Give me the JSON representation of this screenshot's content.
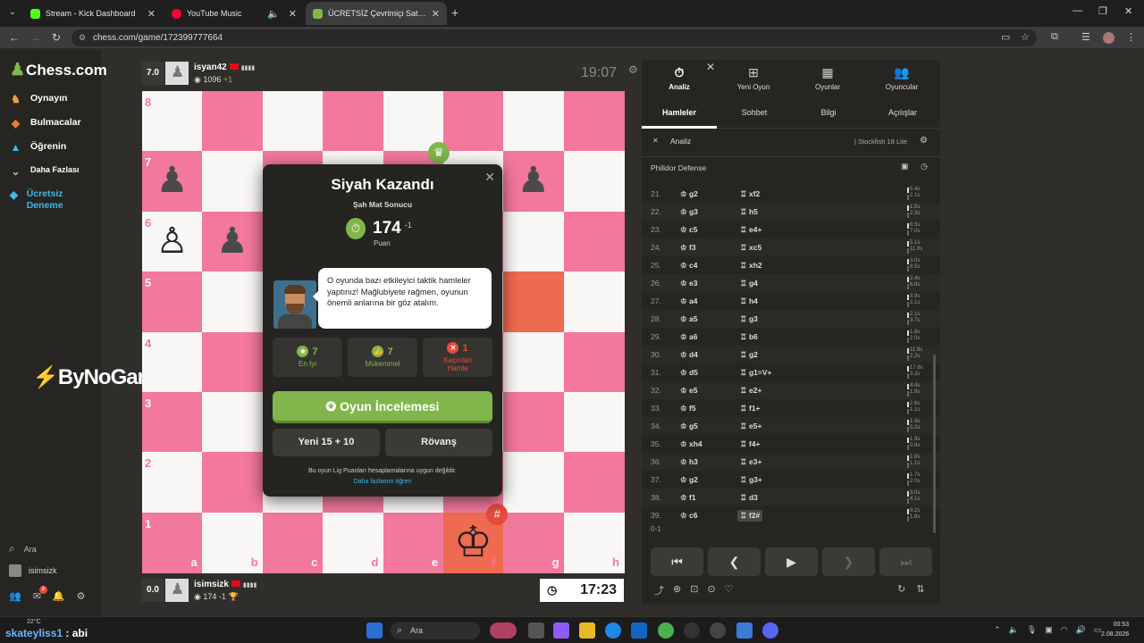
{
  "browser": {
    "tabs": [
      {
        "title": "Stream - Kick Dashboard",
        "favicon_color": "#53fc18",
        "active": false
      },
      {
        "title": "YouTube Music",
        "favicon_color": "#ff0033",
        "active": false
      },
      {
        "title": "ÜCRETSİZ Çevrimiçi Satranç Oy",
        "favicon_color": "#81b64c",
        "active": true
      }
    ],
    "url": "chess.com/game/172399777664"
  },
  "nav": {
    "logo_text": "Chess.com",
    "items": [
      {
        "label": "Oynayın",
        "icon": "play-icon"
      },
      {
        "label": "Bulmacalar",
        "icon": "puzzle-icon"
      },
      {
        "label": "Öğrenin",
        "icon": "learn-icon"
      },
      {
        "label": "Daha Fazlası",
        "icon": "chevron-down-icon"
      },
      {
        "label": "Ücretsiz Deneme",
        "icon": "diamond-icon"
      }
    ],
    "search_label": "Ara",
    "username": "isimsizk",
    "notifications_count": "3"
  },
  "overlay": {
    "brand": "ByNoGame"
  },
  "top_player": {
    "eval": "7.0",
    "name": "isyan42",
    "rating": "1096",
    "rating_change": "+1",
    "clock": "19:07"
  },
  "bottom_player": {
    "eval": "0.0",
    "name": "isimsizk",
    "rating": "174",
    "rating_change": "-1",
    "clock": "17:23"
  },
  "board": {
    "files": [
      "a",
      "b",
      "c",
      "d",
      "e",
      "f",
      "g",
      "h"
    ],
    "ranks": [
      "8",
      "7",
      "6",
      "5",
      "4",
      "3",
      "2",
      "1"
    ],
    "light_color": "#f9f6f6",
    "dark_color": "#f2789c",
    "highlight_color": "#ee6a50"
  },
  "result_modal": {
    "title": "Siyah Kazandı",
    "subtitle": "Şah Mat Sonucu",
    "score": "174",
    "score_delta": "-1",
    "score_label": "Puan",
    "coach_message": "O oyunda bazı etkileyici taktik hamleler yaptınız! Mağlubiyete rağmen, oyunun önemli anlarına bir göz atalım.",
    "stats": [
      {
        "value": "7",
        "label": "En İyi",
        "color": "#81b64c",
        "icon": "star-icon"
      },
      {
        "value": "7",
        "label": "Mükemmel",
        "color": "#81b64c",
        "icon": "thumbs-up-icon"
      },
      {
        "value": "1",
        "label": "Kaçırılan Hamle",
        "color": "#e64b3b",
        "icon": "x-icon"
      }
    ],
    "review_button": "Oyun İncelemesi",
    "new_game_button": "Yeni 15 + 10",
    "rematch_button": "Rövanş",
    "note": "Bu oyun Lig Puanları hesaplamalarına uygun değildir.",
    "note_link": "Daha fazlasını öğren"
  },
  "panel": {
    "top_tabs": [
      {
        "label": "Analiz",
        "icon": "stopwatch-icon"
      },
      {
        "label": "Yeni Oyun",
        "icon": "plus-icon"
      },
      {
        "label": "Oyunlar",
        "icon": "board-icon"
      },
      {
        "label": "Oyuncular",
        "icon": "players-icon"
      }
    ],
    "sub_tabs": [
      "Hamleler",
      "Sohbet",
      "Bilgi",
      "Açılışlar"
    ],
    "analysis_label": "Analiz",
    "engine_label": "Stockfish 18 Lite",
    "opening": "Philidor Defense",
    "moves": [
      {
        "n": "21.",
        "w": "g2",
        "b": "xf2",
        "t1": "5.4s",
        "t2": "2.1s"
      },
      {
        "n": "22.",
        "w": "g3",
        "b": "h5",
        "t1": "1.5s",
        "t2": "2.3s"
      },
      {
        "n": "23.",
        "w": "c5",
        "b": "e4+",
        "t1": "8.5s",
        "t2": "7.0s"
      },
      {
        "n": "24.",
        "w": "f3",
        "b": "xc5",
        "t1": "5.1s",
        "t2": "11.0s"
      },
      {
        "n": "25.",
        "w": "c4",
        "b": "xh2",
        "t1": "3.0s",
        "t2": "8.5s"
      },
      {
        "n": "26.",
        "w": "e3",
        "b": "g4",
        "t1": "2.4s",
        "t2": "6.8s"
      },
      {
        "n": "27.",
        "w": "a4",
        "b": "h4",
        "t1": "3.9s",
        "t2": "2.1s"
      },
      {
        "n": "28.",
        "w": "a5",
        "b": "g3",
        "t1": "2.1s",
        "t2": "3.7s"
      },
      {
        "n": "29.",
        "w": "a6",
        "b": "b6",
        "t1": "1.8s",
        "t2": "2.0s"
      },
      {
        "n": "30.",
        "w": "d4",
        "b": "g2",
        "t1": "11.9s",
        "t2": "2.2s"
      },
      {
        "n": "31.",
        "w": "d5",
        "b": "g1=V+",
        "t1": "17.8s",
        "t2": "3.2s"
      },
      {
        "n": "32.",
        "w": "e5",
        "b": "e2+",
        "t1": "4.4s",
        "t2": "1.9s"
      },
      {
        "n": "33.",
        "w": "f5",
        "b": "f1+",
        "t1": "2.6s",
        "t2": "1.1s"
      },
      {
        "n": "34.",
        "w": "g5",
        "b": "e5+",
        "t1": "1.4s",
        "t2": "5.2s"
      },
      {
        "n": "35.",
        "w": "xh4",
        "b": "f4+",
        "t1": "1.9s",
        "t2": "0.9s"
      },
      {
        "n": "36.",
        "w": "h3",
        "b": "e3+",
        "t1": "1.6s",
        "t2": "1.1s"
      },
      {
        "n": "37.",
        "w": "g2",
        "b": "g3+",
        "t1": "1.7s",
        "t2": "2.0s"
      },
      {
        "n": "38.",
        "w": "f1",
        "b": "d3",
        "t1": "3.0s",
        "t2": "4.1s"
      },
      {
        "n": "39.",
        "w": "c6",
        "b": "f2#",
        "t1": "9.2s",
        "t2": "1.8s"
      }
    ],
    "result": "0-1"
  },
  "taskbar": {
    "weather": "22°C",
    "user_text_a": "skateyliss1",
    "user_text_b": "abi",
    "search": "Ara",
    "time": "00:53",
    "date": "2.08.2026"
  }
}
